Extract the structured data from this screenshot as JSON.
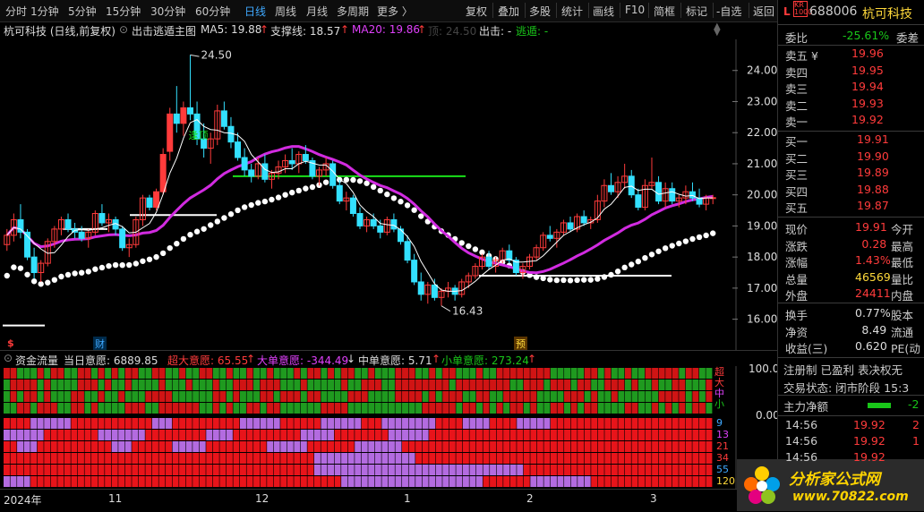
{
  "toolbar": {
    "periods": [
      "分时",
      "1分钟",
      "5分钟",
      "15分钟",
      "30分钟",
      "60分钟",
      "日线",
      "周线",
      "月线",
      "多周期",
      "更多 〉"
    ],
    "active_period": "日线",
    "actions": [
      "复权",
      "叠加",
      "多股",
      "统计",
      "画线",
      "F10",
      "简框",
      "标记",
      "-自选",
      "返回"
    ]
  },
  "infobar": {
    "stock": "杭可科技 (日线,前复权)",
    "indicator": "出击逃遁主图",
    "ma5": "MA5: 19.88",
    "support": "支撑线: 18.57",
    "ma20": "MA20: 19.86",
    "ghost": "顶: 24.50",
    "attack": "出击: -",
    "escape": "逃遁: -"
  },
  "chart": {
    "price_axis": [
      "24.00",
      "23.00",
      "22.00",
      "21.00",
      "20.00",
      "19.00",
      "18.00",
      "17.00",
      "16.00"
    ],
    "high_label": "24.50",
    "low_label": "16.43",
    "top_marker": "逢顶",
    "event_markers": [
      "$",
      "财",
      "预"
    ]
  },
  "chart_data": {
    "type": "candlestick",
    "ylim": [
      15.5,
      25.0
    ],
    "candles": [
      [
        18.4,
        18.9,
        18.2,
        18.7
      ],
      [
        18.7,
        19.4,
        18.5,
        19.2
      ],
      [
        19.2,
        19.7,
        18.6,
        18.8
      ],
      [
        18.8,
        18.9,
        17.9,
        18.0
      ],
      [
        18.0,
        18.3,
        17.3,
        17.5
      ],
      [
        17.5,
        17.9,
        17.2,
        17.8
      ],
      [
        17.8,
        18.6,
        17.7,
        18.5
      ],
      [
        18.5,
        19.0,
        18.3,
        18.9
      ],
      [
        18.9,
        19.3,
        18.7,
        19.2
      ],
      [
        19.2,
        19.4,
        18.8,
        18.9
      ],
      [
        18.9,
        19.1,
        18.6,
        18.8
      ],
      [
        18.8,
        19.0,
        18.5,
        18.6
      ],
      [
        18.6,
        18.9,
        18.3,
        18.8
      ],
      [
        18.8,
        19.5,
        18.7,
        19.4
      ],
      [
        19.4,
        19.7,
        19.0,
        19.1
      ],
      [
        19.1,
        19.4,
        18.8,
        19.2
      ],
      [
        19.2,
        19.3,
        18.7,
        18.9
      ],
      [
        18.9,
        19.0,
        18.2,
        18.3
      ],
      [
        18.3,
        18.6,
        18.0,
        18.4
      ],
      [
        18.4,
        19.3,
        18.3,
        19.2
      ],
      [
        19.2,
        20.0,
        19.0,
        19.9
      ],
      [
        19.9,
        20.0,
        19.5,
        19.6
      ],
      [
        19.6,
        20.2,
        19.5,
        20.1
      ],
      [
        20.1,
        21.5,
        20.0,
        21.3
      ],
      [
        21.4,
        22.8,
        21.1,
        22.6
      ],
      [
        22.6,
        23.5,
        22.0,
        22.3
      ],
      [
        22.3,
        23.0,
        21.9,
        22.8
      ],
      [
        22.8,
        24.5,
        22.4,
        22.6
      ],
      [
        22.6,
        23.0,
        21.6,
        21.8
      ],
      [
        21.8,
        22.3,
        21.2,
        21.5
      ],
      [
        21.5,
        22.0,
        21.0,
        21.8
      ],
      [
        21.8,
        22.9,
        21.6,
        22.7
      ],
      [
        22.7,
        23.0,
        22.1,
        22.2
      ],
      [
        22.2,
        22.5,
        21.5,
        21.7
      ],
      [
        21.7,
        22.0,
        21.1,
        21.2
      ],
      [
        21.2,
        21.5,
        20.6,
        20.8
      ],
      [
        20.8,
        21.0,
        20.4,
        20.6
      ],
      [
        20.6,
        21.2,
        20.5,
        21.0
      ],
      [
        21.0,
        21.3,
        20.4,
        20.5
      ],
      [
        20.5,
        20.8,
        20.2,
        20.7
      ],
      [
        20.7,
        21.1,
        20.5,
        20.9
      ],
      [
        20.9,
        21.3,
        20.7,
        21.1
      ],
      [
        21.1,
        21.5,
        20.8,
        21.0
      ],
      [
        21.0,
        21.4,
        20.7,
        21.3
      ],
      [
        21.3,
        21.6,
        21.0,
        21.1
      ],
      [
        21.1,
        21.2,
        20.5,
        20.6
      ],
      [
        20.6,
        20.9,
        20.3,
        20.8
      ],
      [
        20.8,
        21.2,
        20.6,
        21.0
      ],
      [
        21.0,
        21.1,
        20.2,
        20.3
      ],
      [
        20.3,
        20.5,
        19.7,
        19.8
      ],
      [
        19.8,
        20.1,
        19.5,
        19.9
      ],
      [
        19.9,
        20.0,
        19.3,
        19.4
      ],
      [
        19.4,
        19.6,
        18.9,
        19.0
      ],
      [
        19.0,
        19.3,
        18.8,
        19.2
      ],
      [
        19.2,
        19.4,
        18.9,
        19.0
      ],
      [
        19.0,
        19.2,
        18.6,
        18.8
      ],
      [
        18.8,
        19.3,
        18.7,
        19.2
      ],
      [
        19.2,
        19.4,
        18.8,
        18.9
      ],
      [
        18.9,
        19.0,
        18.4,
        18.5
      ],
      [
        18.5,
        18.7,
        17.8,
        17.9
      ],
      [
        17.9,
        18.1,
        17.1,
        17.2
      ],
      [
        17.2,
        17.5,
        16.6,
        16.8
      ],
      [
        16.8,
        17.2,
        16.5,
        17.1
      ],
      [
        17.1,
        17.3,
        16.6,
        16.7
      ],
      [
        16.7,
        17.0,
        16.43,
        16.9
      ],
      [
        16.9,
        17.2,
        16.7,
        17.0
      ],
      [
        17.0,
        17.1,
        16.6,
        16.8
      ],
      [
        16.8,
        17.3,
        16.7,
        17.2
      ],
      [
        17.2,
        17.5,
        17.0,
        17.4
      ],
      [
        17.4,
        17.8,
        17.3,
        17.7
      ],
      [
        17.7,
        18.1,
        17.6,
        18.0
      ],
      [
        18.0,
        18.2,
        17.6,
        17.7
      ],
      [
        17.7,
        18.0,
        17.5,
        17.9
      ],
      [
        17.9,
        18.3,
        17.8,
        18.2
      ],
      [
        18.2,
        18.4,
        17.8,
        17.9
      ],
      [
        17.9,
        18.0,
        17.4,
        17.5
      ],
      [
        17.5,
        17.8,
        17.3,
        17.7
      ],
      [
        17.7,
        18.1,
        17.6,
        18.0
      ],
      [
        18.0,
        18.4,
        17.9,
        18.3
      ],
      [
        18.3,
        18.8,
        18.2,
        18.7
      ],
      [
        18.7,
        19.0,
        18.5,
        18.6
      ],
      [
        18.6,
        18.9,
        18.3,
        18.8
      ],
      [
        18.8,
        19.2,
        18.7,
        19.1
      ],
      [
        19.1,
        19.3,
        18.8,
        18.9
      ],
      [
        18.9,
        19.4,
        18.8,
        19.3
      ],
      [
        19.3,
        19.5,
        19.0,
        19.1
      ],
      [
        19.1,
        19.3,
        18.9,
        19.2
      ],
      [
        19.2,
        20.0,
        19.1,
        19.8
      ],
      [
        19.8,
        20.5,
        19.6,
        20.3
      ],
      [
        20.3,
        20.7,
        20.0,
        20.1
      ],
      [
        20.1,
        20.6,
        19.9,
        20.4
      ],
      [
        20.4,
        21.0,
        20.2,
        20.6
      ],
      [
        20.6,
        20.8,
        19.9,
        20.0
      ],
      [
        20.0,
        20.2,
        19.5,
        19.6
      ],
      [
        19.6,
        20.5,
        19.5,
        20.3
      ],
      [
        20.3,
        21.2,
        20.2,
        20.4
      ],
      [
        20.4,
        20.6,
        19.7,
        19.8
      ],
      [
        19.8,
        20.4,
        19.6,
        20.2
      ],
      [
        20.2,
        20.4,
        19.7,
        19.8
      ],
      [
        19.8,
        20.0,
        19.6,
        19.9
      ],
      [
        19.9,
        20.3,
        19.7,
        20.1
      ],
      [
        20.1,
        20.4,
        19.8,
        19.9
      ],
      [
        19.9,
        20.2,
        19.6,
        19.7
      ],
      [
        19.7,
        20.0,
        19.5,
        19.9
      ],
      [
        19.9,
        20.0,
        19.7,
        19.91
      ]
    ]
  },
  "lower": {
    "title": "资金流量",
    "today": "当日意愿: 6889.85",
    "super": "超大意愿: 65.55",
    "large": "大单意愿: -344.49",
    "medium": "中单意愿: 5.71",
    "small": "小单意愿: 273.24",
    "axis_top": "100.0",
    "axis_zero": "0.00",
    "row_labels": [
      "超",
      "大",
      "中",
      "小"
    ],
    "period_labels": [
      "9",
      "13",
      "21",
      "34",
      "55",
      "120"
    ]
  },
  "date_axis": [
    "2024年",
    "11",
    "12",
    "1",
    "2",
    "3"
  ],
  "quote": {
    "code_badge": "L KR 1000",
    "code": "688006",
    "name": "杭可科技",
    "weibi_label": "委比",
    "weibi_value": "-25.61%",
    "weicha_label": "委差",
    "asks": [
      {
        "label": "卖五 ¥",
        "price": "19.96"
      },
      {
        "label": "卖四",
        "price": "19.95"
      },
      {
        "label": "卖三",
        "price": "19.94"
      },
      {
        "label": "卖二",
        "price": "19.93"
      },
      {
        "label": "卖一",
        "price": "19.92"
      }
    ],
    "bids": [
      {
        "label": "买一",
        "price": "19.91"
      },
      {
        "label": "买二",
        "price": "19.90"
      },
      {
        "label": "买三",
        "price": "19.89"
      },
      {
        "label": "买四",
        "price": "19.88"
      },
      {
        "label": "买五",
        "price": "19.87"
      }
    ],
    "stats": [
      {
        "label": "现价",
        "value": "19.91",
        "label2": "今开"
      },
      {
        "label": "涨跌",
        "value": "0.28",
        "label2": "最高"
      },
      {
        "label": "涨幅",
        "value": "1.43%",
        "label2": "最低"
      },
      {
        "label": "总量",
        "value": "46569",
        "label2": "量比"
      },
      {
        "label": "外盘",
        "value": "24411",
        "label2": "内盘"
      }
    ],
    "stats2": [
      {
        "label": "换手",
        "value": "0.77%",
        "label2": "股本"
      },
      {
        "label": "净资",
        "value": "8.49",
        "label2": "流通"
      },
      {
        "label": "收益(三)",
        "value": "0.620",
        "label2": "PE(动"
      }
    ],
    "tags": "注册制 已盈利 表决权无",
    "trade_status": "交易状态: 闭市阶段 15:3",
    "main_flow": "主力净额",
    "main_flow_value": "-2",
    "ticks": [
      {
        "time": "14:56",
        "price": "19.92",
        "vol": "2"
      },
      {
        "time": "14:56",
        "price": "19.92",
        "vol": "1"
      },
      {
        "time": "14:56",
        "price": "19.92",
        "vol": ""
      }
    ]
  },
  "watermark": {
    "site": "分析家公式网",
    "url": "www.70822.com"
  }
}
